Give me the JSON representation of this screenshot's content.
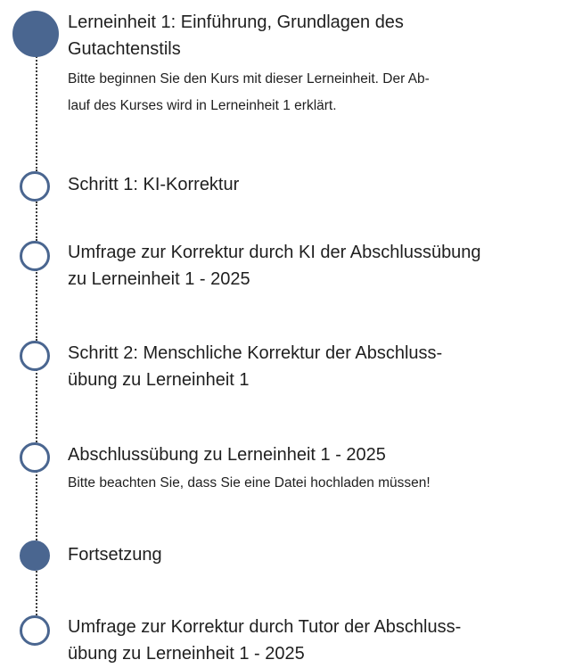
{
  "timeline": {
    "items": [
      {
        "title_line1": "Lerneinheit 1: Einführung, Grundlagen des",
        "title_line2": "Gutachtenstils",
        "desc_line1": "Bitte beginnen Sie den Kurs mit dieser Lerneinheit. Der Ab-",
        "desc_line2": "lauf des Kurses wird in Lerneinheit 1 erklärt.",
        "status": "filled"
      },
      {
        "title_line1": "Schritt 1: KI-Korrektur",
        "status": "hollow"
      },
      {
        "title_line1": "Umfrage zur Korrektur durch KI der Abschlussübung",
        "title_line2": "zu Lerneinheit 1 - 2025",
        "status": "hollow"
      },
      {
        "title_line1": "Schritt 2: Menschliche Korrektur der Abschluss-",
        "title_line2": "übung zu Lerneinheit 1",
        "status": "hollow"
      },
      {
        "title_line1": "Abschlussübung zu Lerneinheit 1 - 2025",
        "desc_line1": "Bitte beachten Sie, dass Sie eine Datei hochladen müssen!",
        "status": "hollow"
      },
      {
        "title_line1": "Fortsetzung",
        "status": "filled"
      },
      {
        "title_line1": "Umfrage zur Korrektur durch Tutor der Abschluss-",
        "title_line2": "übung zu Lerneinheit 1 - 2025",
        "status": "hollow"
      }
    ]
  },
  "colors": {
    "accent": "#4a6690",
    "text": "#1f1f1f",
    "rail": "#3a3a3a"
  }
}
